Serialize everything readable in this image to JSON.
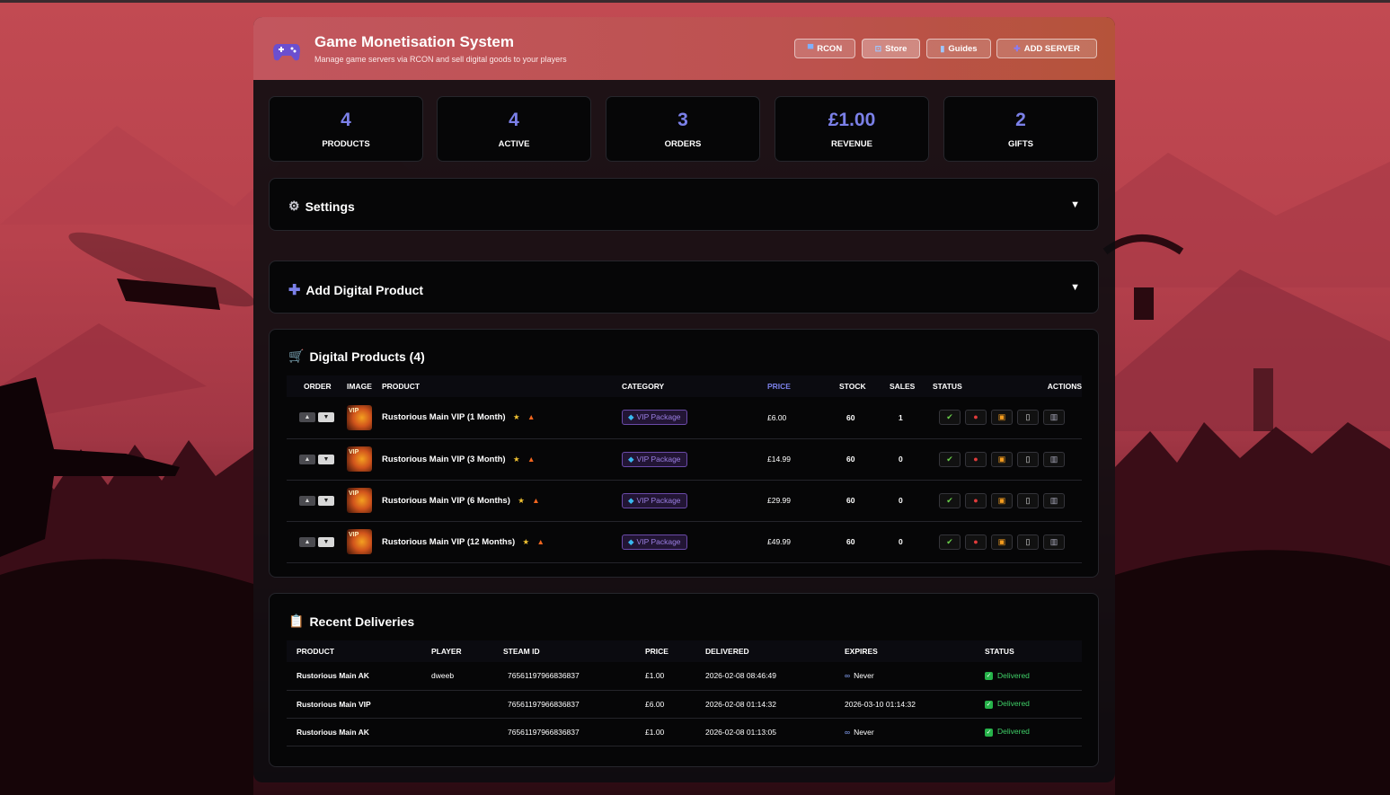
{
  "header": {
    "title": "Game Monetisation System",
    "subtitle": "Manage game servers via RCON and sell digital goods to your players",
    "buttons": {
      "rcon": "RCON",
      "store": "Store",
      "guides": "Guides",
      "add_server": "ADD SERVER"
    }
  },
  "stats": [
    {
      "value": "4",
      "label": "PRODUCTS"
    },
    {
      "value": "4",
      "label": "ACTIVE"
    },
    {
      "value": "3",
      "label": "ORDERS"
    },
    {
      "value": "£1.00",
      "label": "REVENUE"
    },
    {
      "value": "2",
      "label": "GIFTS"
    }
  ],
  "settings": {
    "title": "Settings"
  },
  "add_product": {
    "title": "Add Digital Product"
  },
  "products": {
    "title": "Digital Products (4)",
    "columns": {
      "order": "ORDER",
      "image": "IMAGE",
      "product": "PRODUCT",
      "category": "CATEGORY",
      "price": "PRICE",
      "stock": "STOCK",
      "sales": "SALES",
      "status": "STATUS",
      "actions": "ACTIONS"
    },
    "rows": [
      {
        "name": "Rustorious Main VIP (1 Month)",
        "category": "VIP Package",
        "price": "£6.00",
        "stock": "60",
        "sales": "1"
      },
      {
        "name": "Rustorious Main VIP (3 Month)",
        "category": "VIP Package",
        "price": "£14.99",
        "stock": "60",
        "sales": "0"
      },
      {
        "name": "Rustorious Main VIP (6 Months)",
        "category": "VIP Package",
        "price": "£29.99",
        "stock": "60",
        "sales": "0"
      },
      {
        "name": "Rustorious Main VIP (12 Months)",
        "category": "VIP Package",
        "price": "£49.99",
        "stock": "60",
        "sales": "0"
      }
    ],
    "thumb_label": "VIP"
  },
  "deliveries": {
    "title": "Recent Deliveries",
    "columns": {
      "product": "PRODUCT",
      "player": "PLAYER",
      "steam_id": "STEAM ID",
      "price": "PRICE",
      "delivered": "DELIVERED",
      "expires": "EXPIRES",
      "status": "STATUS"
    },
    "rows": [
      {
        "product": "Rustorious Main AK",
        "player": "dweeb",
        "steam_id": "76561197966836837",
        "price": "£1.00",
        "delivered": "2026-02-08 08:46:49",
        "expires": "Never",
        "expires_infinite": true,
        "status": "Delivered"
      },
      {
        "product": "Rustorious Main VIP",
        "player": "",
        "steam_id": "76561197966836837",
        "price": "£6.00",
        "delivered": "2026-02-08 01:14:32",
        "expires": "2026-03-10 01:14:32",
        "expires_infinite": false,
        "status": "Delivered"
      },
      {
        "product": "Rustorious Main AK",
        "player": "",
        "steam_id": "76561197966836837",
        "price": "£1.00",
        "delivered": "2026-02-08 01:13:05",
        "expires": "Never",
        "expires_infinite": true,
        "status": "Delivered"
      }
    ]
  },
  "colors": {
    "accent": "#7b80e8",
    "header_start": "#c2565e",
    "header_end": "#b5533a",
    "delivered": "#3fcf67"
  }
}
